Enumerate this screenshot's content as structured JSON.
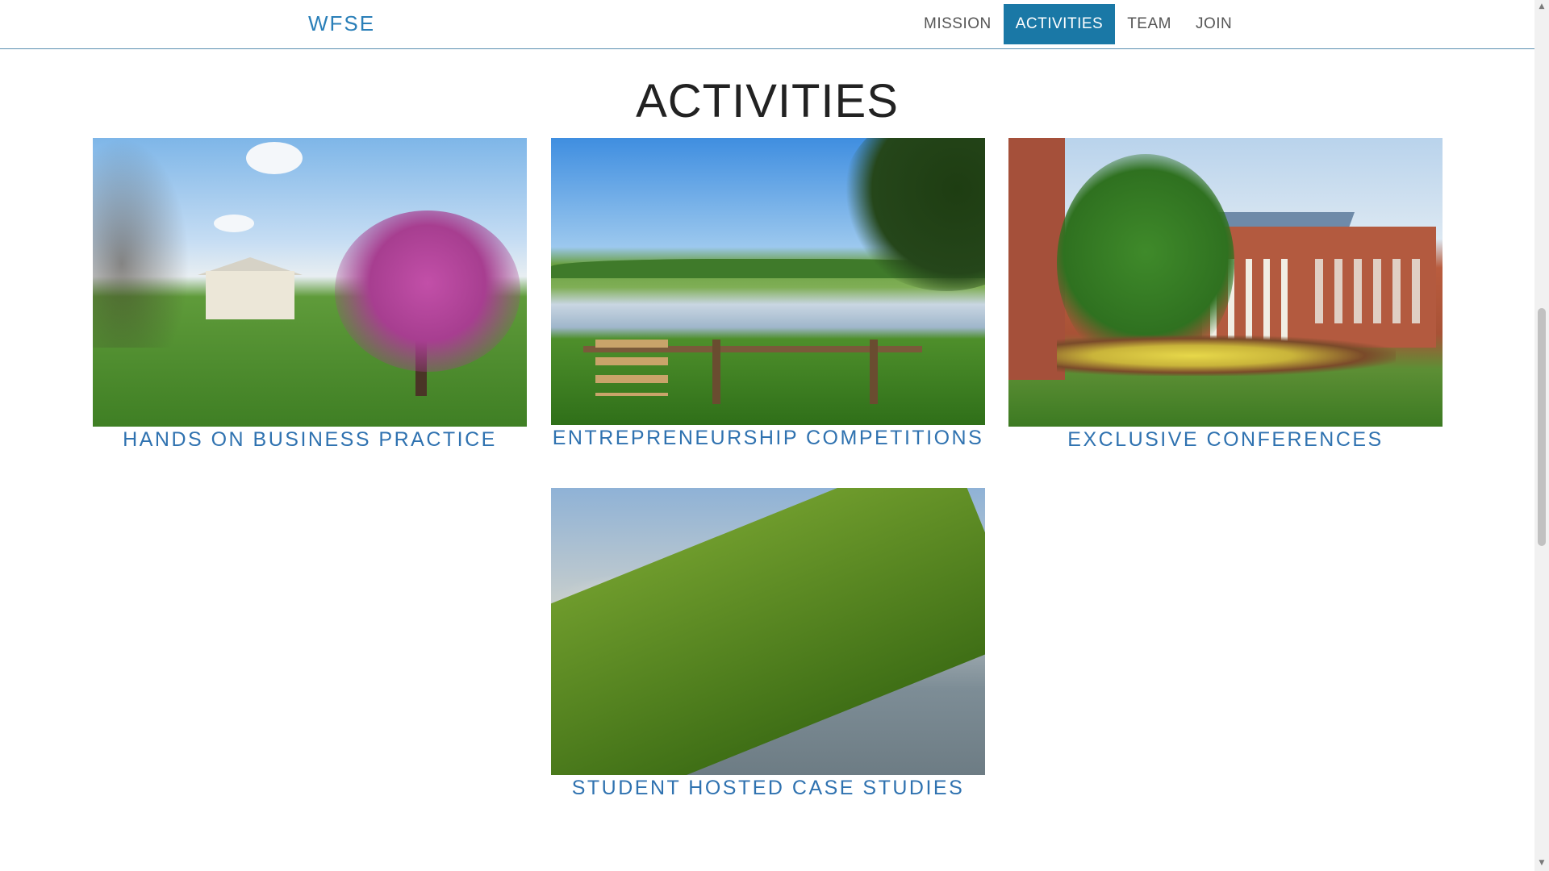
{
  "header": {
    "brand": "WFSE",
    "nav": [
      {
        "label": "MISSION",
        "active": false
      },
      {
        "label": "ACTIVITIES",
        "active": true
      },
      {
        "label": "TEAM",
        "active": false
      },
      {
        "label": "JOIN",
        "active": false
      }
    ]
  },
  "section": {
    "title": "ACTIVITIES"
  },
  "activities": [
    {
      "caption": "HANDS ON BUSINESS PRACTICE",
      "image": "estate-magnolia-photo"
    },
    {
      "caption": "ENTREPRENEURSHIP COMPETITIONS",
      "image": "pond-fence-photo"
    },
    {
      "caption": "EXCLUSIVE CONFERENCES",
      "image": "brick-building-photo"
    },
    {
      "caption": "STUDENT HOSTED CASE STUDIES",
      "image": "misty-lake-photo"
    }
  ],
  "scrollbar": {
    "up_icon": "scroll-up-arrow-icon",
    "down_icon": "scroll-down-arrow-icon"
  },
  "colors": {
    "accent": "#1a78a6",
    "brand": "#2a7fb8",
    "caption": "#2f72b0"
  }
}
